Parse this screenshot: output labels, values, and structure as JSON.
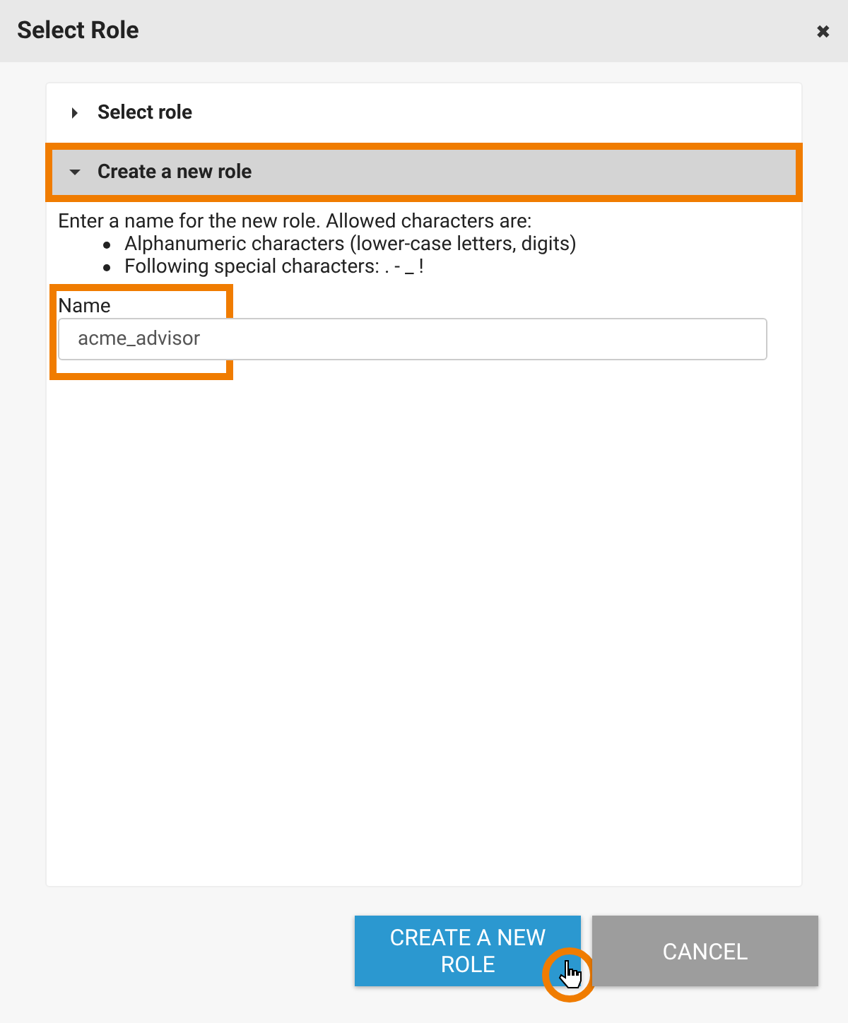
{
  "dialog": {
    "title": "Select Role",
    "close": "✖"
  },
  "sections": [
    {
      "title": "Select role",
      "expanded": false,
      "highlighted": false
    },
    {
      "title": "Create a new role",
      "expanded": true,
      "highlighted": true
    }
  ],
  "intro": "Enter a name for the new role. Allowed characters are:",
  "rules": [
    "Alphanumeric characters (lower-case letters, digits)",
    "Following special characters: . - _ !"
  ],
  "field": {
    "label": "Name",
    "value": "acme_advisor",
    "highlighted": true
  },
  "buttons": [
    {
      "label": "CREATE A NEW ROLE",
      "kind": "primary",
      "cursor": true
    },
    {
      "label": "CANCEL",
      "kind": "secondary",
      "cursor": false
    }
  ]
}
